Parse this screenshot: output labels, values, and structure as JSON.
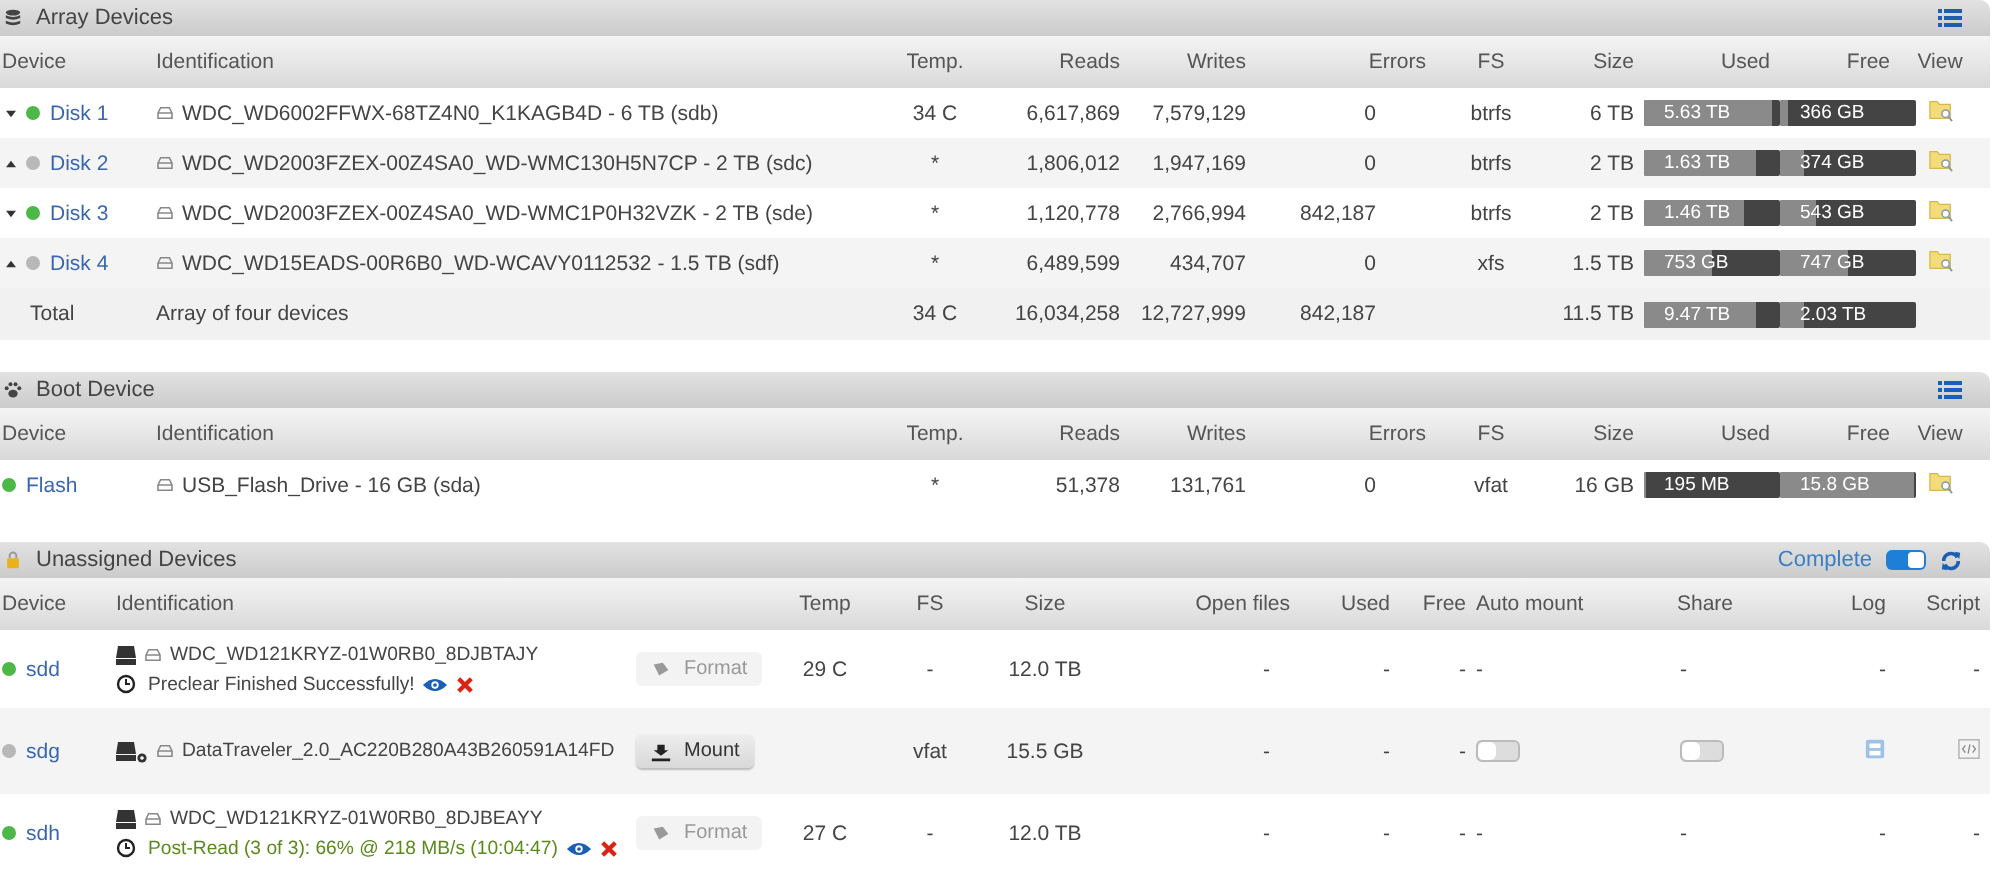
{
  "array": {
    "title": "Array Devices",
    "columns": [
      "Device",
      "Identification",
      "Temp.",
      "Reads",
      "Writes",
      "Errors",
      "FS",
      "Size",
      "Used",
      "Free",
      "View"
    ],
    "rows": [
      {
        "expanded": true,
        "online": true,
        "name": "Disk 1",
        "identification": "WDC_WD6002FFWX-68TZ4N0_K1KAGB4D - 6 TB (sdb)",
        "temp": "34 C",
        "reads": "6,617,869",
        "writes": "7,579,129",
        "errors": "0",
        "fs": "btrfs",
        "size": "6 TB",
        "used": {
          "text": "5.63 TB",
          "level": 0.94
        },
        "free": {
          "text": "366 GB",
          "level": 0.06
        }
      },
      {
        "expanded": false,
        "online": false,
        "name": "Disk 2",
        "identification": "WDC_WD2003FZEX-00Z4SA0_WD-WMC130H5N7CP - 2 TB (sdc)",
        "temp": "*",
        "reads": "1,806,012",
        "writes": "1,947,169",
        "errors": "0",
        "fs": "btrfs",
        "size": "2 TB",
        "used": {
          "text": "1.63 TB",
          "level": 0.82
        },
        "free": {
          "text": "374 GB",
          "level": 0.18
        }
      },
      {
        "expanded": true,
        "online": true,
        "name": "Disk 3",
        "identification": "WDC_WD2003FZEX-00Z4SA0_WD-WMC1P0H32VZK - 2 TB (sde)",
        "temp": "*",
        "reads": "1,120,778",
        "writes": "2,766,994",
        "errors": "842,187",
        "fs": "btrfs",
        "size": "2 TB",
        "used": {
          "text": "1.46 TB",
          "level": 0.73
        },
        "free": {
          "text": "543 GB",
          "level": 0.27
        }
      },
      {
        "expanded": false,
        "online": false,
        "name": "Disk 4",
        "identification": "WDC_WD15EADS-00R6B0_WD-WCAVY0112532 - 1.5 TB (sdf)",
        "temp": "*",
        "reads": "6,489,599",
        "writes": "434,707",
        "errors": "0",
        "fs": "xfs",
        "size": "1.5 TB",
        "used": {
          "text": "753 GB",
          "level": 0.5
        },
        "free": {
          "text": "747 GB",
          "level": 0.5
        }
      }
    ],
    "total": {
      "label": "Total",
      "identification": "Array of four devices",
      "temp": "34 C",
      "reads": "16,034,258",
      "writes": "12,727,999",
      "errors": "842,187",
      "size": "11.5 TB",
      "used": {
        "text": "9.47 TB",
        "level": 0.82
      },
      "free": {
        "text": "2.03 TB",
        "level": 0.18
      }
    }
  },
  "boot": {
    "title": "Boot Device",
    "columns": [
      "Device",
      "Identification",
      "Temp.",
      "Reads",
      "Writes",
      "Errors",
      "FS",
      "Size",
      "Used",
      "Free",
      "View"
    ],
    "rows": [
      {
        "online": true,
        "name": "Flash",
        "identification": "USB_Flash_Drive - 16 GB (sda)",
        "temp": "*",
        "reads": "51,378",
        "writes": "131,761",
        "errors": "0",
        "fs": "vfat",
        "size": "16 GB",
        "used": {
          "text": "195 MB",
          "level": 0.01
        },
        "free": {
          "text": "15.8 GB",
          "level": 0.99
        }
      }
    ]
  },
  "unassigned": {
    "title": "Unassigned Devices",
    "mode_label": "Complete",
    "mode_on": true,
    "columns": [
      "Device",
      "Identification",
      "",
      "Temp",
      "FS",
      "Size",
      "Open files",
      "Used",
      "Free",
      "Auto mount",
      "Share",
      "Log",
      "Script"
    ],
    "rows": [
      {
        "online": true,
        "name": "sdd",
        "badge": false,
        "identification": "WDC_WD121KRYZ-01W0RB0_8DJBTAJY",
        "status": {
          "kind": "success",
          "text": "Preclear Finished Successfully!"
        },
        "button": {
          "label": "Format",
          "enabled": false
        },
        "temp": "29 C",
        "fs": "-",
        "size": "12.0 TB",
        "open_files": "-",
        "used": "-",
        "free": "-",
        "auto_mount": {
          "kind": "text",
          "text": "-"
        },
        "share": {
          "kind": "text",
          "text": "-"
        },
        "log": {
          "kind": "text",
          "text": "-"
        },
        "script": {
          "kind": "text",
          "text": "-"
        }
      },
      {
        "online": false,
        "name": "sdg",
        "badge": true,
        "identification": "DataTraveler_2.0_AC220B280A43B260591A14FD",
        "button": {
          "label": "Mount",
          "enabled": true
        },
        "fs": "vfat",
        "size": "15.5 GB",
        "open_files": "-",
        "used": "-",
        "free": "-",
        "auto_mount": {
          "kind": "toggle",
          "on": false
        },
        "share": {
          "kind": "toggle",
          "on": false
        },
        "log": {
          "kind": "icon"
        },
        "script": {
          "kind": "icon"
        }
      },
      {
        "online": true,
        "name": "sdh",
        "badge": false,
        "identification": "WDC_WD121KRYZ-01W0RB0_8DJBEAYY",
        "status": {
          "kind": "progress",
          "text": "Post-Read (3 of 3): 66% @ 218 MB/s (10:04:47)"
        },
        "button": {
          "label": "Format",
          "enabled": false
        },
        "temp": "27 C",
        "fs": "-",
        "size": "12.0 TB",
        "open_files": "-",
        "used": "-",
        "free": "-",
        "auto_mount": {
          "kind": "text",
          "text": "-"
        },
        "share": {
          "kind": "text",
          "text": "-"
        },
        "log": {
          "kind": "text",
          "text": "-"
        },
        "script": {
          "kind": "text",
          "text": "-"
        }
      }
    ]
  }
}
